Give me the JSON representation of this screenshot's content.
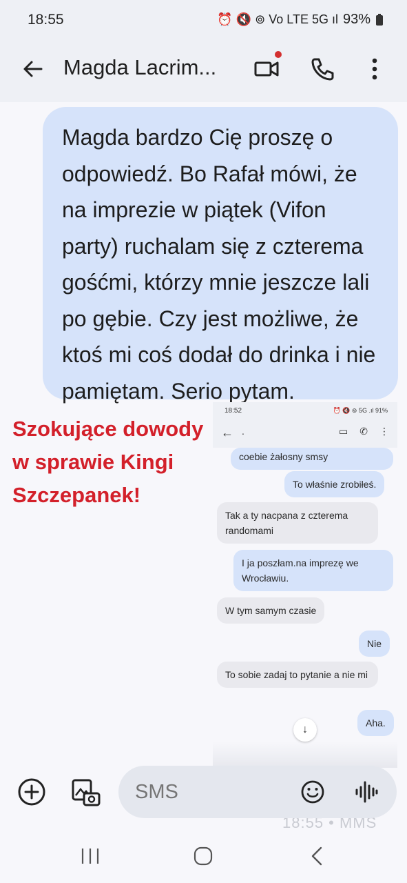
{
  "status_bar": {
    "time": "18:55",
    "icons": "⏰ 🔇 ⊚ Vo LTE 5G ıl",
    "battery": "93%"
  },
  "header": {
    "contact_name": "Magda Lacrim...",
    "video_icon": "video-call-icon",
    "call_icon": "phone-icon",
    "more_icon": "more-vert-icon",
    "accent_dot_color": "#d32f2f"
  },
  "main_message": {
    "text": "Magda bardzo Cię proszę o odpowiedź. Bo Rafał mówi, że na imprezie w piątek (Vifon party) ruchalam się z czterema gośćmi, którzy mnie jeszcze lali po gębie. Czy jest możliwe, że ktoś mi coś dodał do drinka i nie pamiętam. Serio pytam.",
    "bubble_color": "#d6e3fa"
  },
  "caption": {
    "text": "Szokujące dowody w sprawie Kingi Szczepanek!",
    "color": "#d3202a"
  },
  "embedded_screenshot": {
    "time": "18:52",
    "status": "⏰ 🔇 ⊚ 5G .ıl 91%",
    "title": ".",
    "messages": [
      {
        "direction": "out",
        "text": "coebie żałosny smsy"
      },
      {
        "direction": "out",
        "text": "To właśnie zrobiłeś."
      },
      {
        "direction": "in",
        "text": "Tak a ty nacpana z czterema randomami"
      },
      {
        "direction": "out",
        "text": "I ja poszłam.na imprezę we Wrocławiu."
      },
      {
        "direction": "in",
        "text": "W tym samym czasie"
      },
      {
        "direction": "out",
        "text": "Nie"
      },
      {
        "direction": "in",
        "text": "To sobie zadaj to pytanie a nie mi"
      },
      {
        "direction": "out",
        "text": "Aha."
      }
    ],
    "scroll_icon": "arrow-down-icon"
  },
  "ghost_timestamp": "18:55 • MMS",
  "composer": {
    "placeholder": "SMS",
    "add_icon": "add-circle-icon",
    "gallery_icon": "gallery-camera-icon",
    "emoji_icon": "emoji-icon",
    "voice_icon": "voice-wave-icon"
  },
  "nav": {
    "recent_icon": "recent-apps-icon",
    "home_icon": "home-icon",
    "back_icon": "back-icon"
  }
}
